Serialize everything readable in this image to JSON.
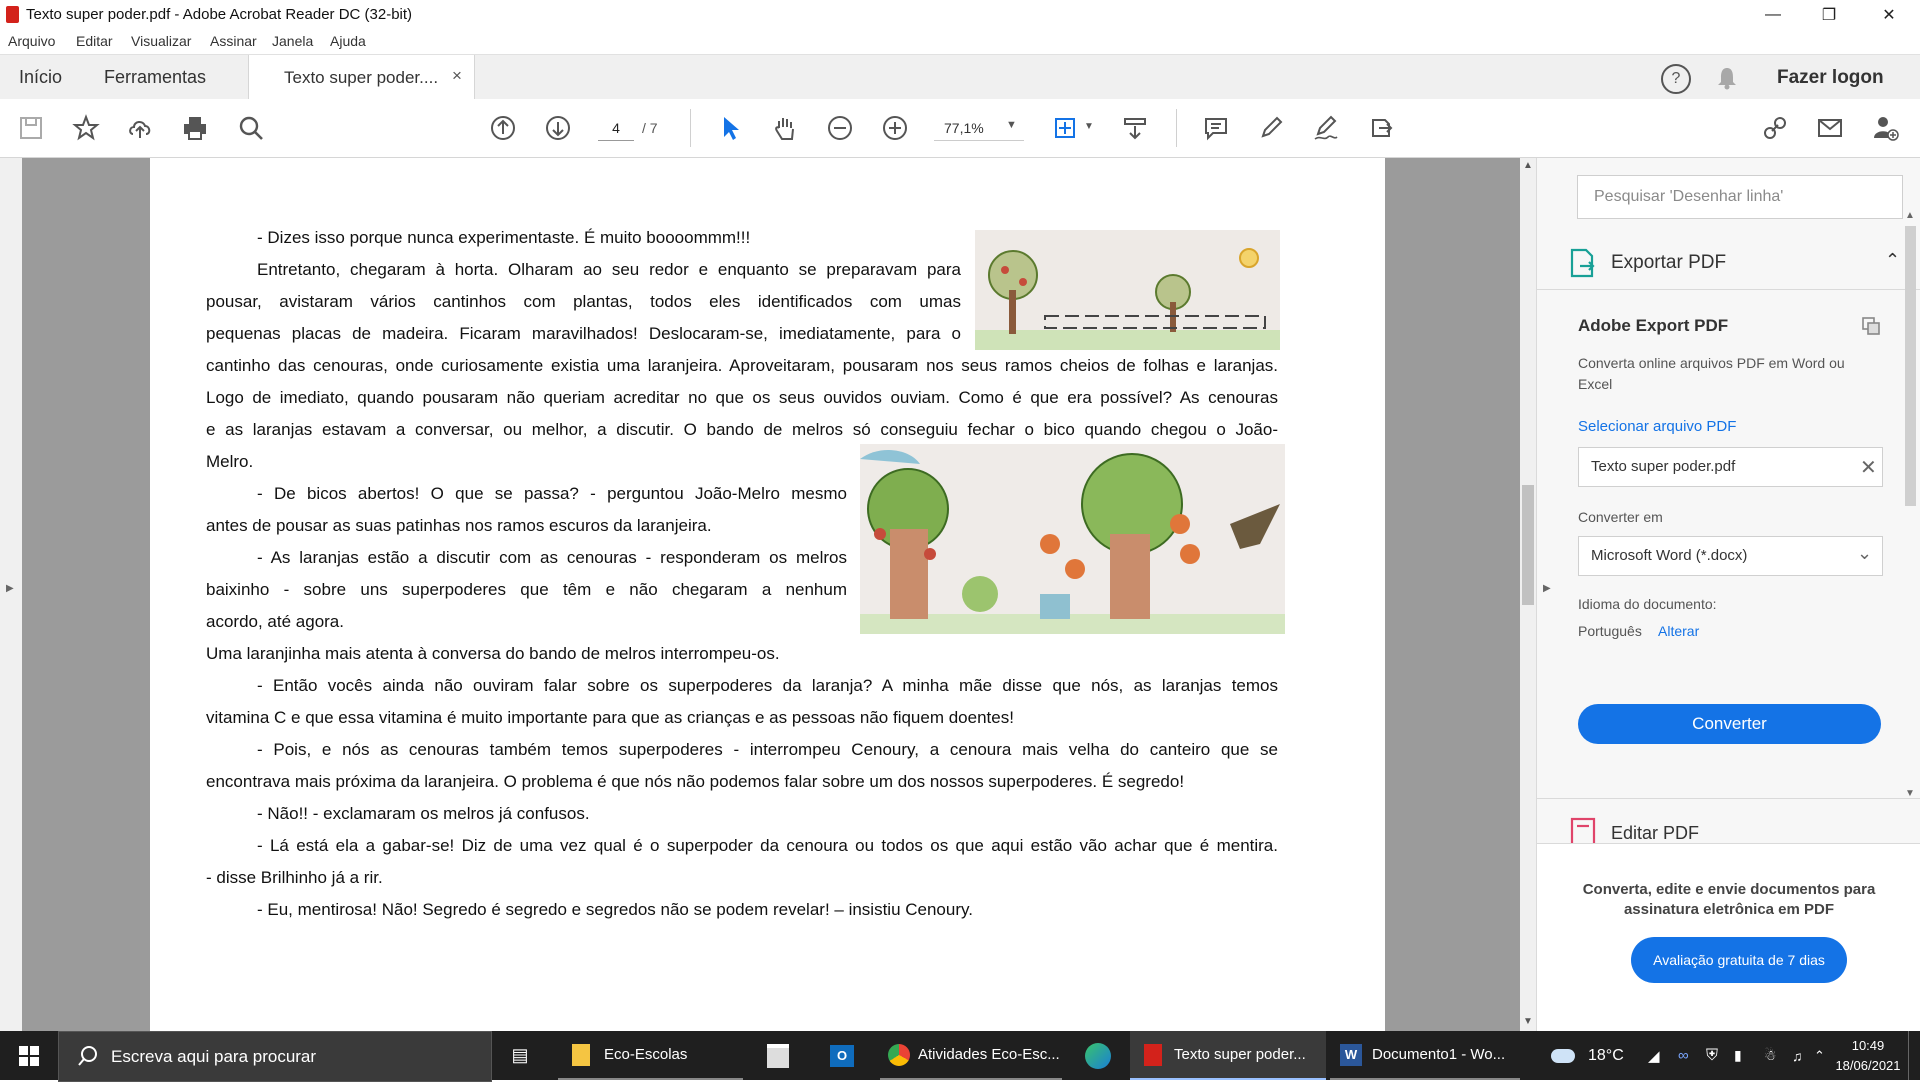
{
  "window": {
    "title": "Texto super poder.pdf - Adobe Acrobat Reader DC (32-bit)"
  },
  "menu": [
    "Arquivo",
    "Editar",
    "Visualizar",
    "Assinar",
    "Janela",
    "Ajuda"
  ],
  "tabs": {
    "home": "Início",
    "tools": "Ferramentas",
    "document": "Texto super poder....",
    "login": "Fazer logon"
  },
  "toolbar": {
    "page_current": "4",
    "page_total": "/ 7",
    "zoom": "77,1%"
  },
  "document": {
    "paragraphs": [
      "- Dizes isso porque nunca experimentaste. É muito boooommm!!!",
      "Entretanto, chegaram à horta. Olharam ao seu redor e enquanto se preparavam para",
      "pousar, avistaram vários cantinhos com plantas, todos eles identificados com umas",
      "pequenas placas de madeira. Ficaram maravilhados! Deslocaram-se, imediatamente, para o",
      "cantinho das cenouras, onde curiosamente existia uma laranjeira. Aproveitaram, pousaram nos seus ramos cheios de folhas e laranjas.",
      "Logo de imediato, quando pousaram não queriam acreditar no que os seus ouvidos ouviam. Como é que era possível? As cenouras",
      "e as laranjas estavam a conversar, ou melhor, a discutir. O bando de melros só conseguiu fechar o bico quando chegou o João-",
      "Melro.",
      "- De bicos abertos! O que se passa? - perguntou João-Melro mesmo",
      "antes de pousar as suas patinhas nos ramos escuros da laranjeira.",
      "- As laranjas estão a discutir com as cenouras - responderam os melros",
      "baixinho - sobre uns superpoderes que têm e não chegaram a nenhum",
      "acordo, até agora.",
      "Uma laranjinha mais atenta à conversa do bando de melros interrompeu-os.",
      "- Então vocês ainda não ouviram falar sobre os superpoderes da laranja? A minha mãe disse que nós, as laranjas temos",
      "vitamina C e que essa vitamina é muito importante para que as crianças e as pessoas não fiquem doentes!",
      "- Pois, e nós as cenouras também temos superpoderes - interrompeu Cenoury, a cenoura mais velha do canteiro que se",
      "encontrava mais próxima da laranjeira. O problema é que nós não podemos falar sobre um dos nossos superpoderes. É segredo!",
      "- Não!! - exclamaram os melros já confusos.",
      "- Lá está ela a gabar-se! Diz de uma vez qual é o superpoder da cenoura ou todos os que aqui estão vão achar que é mentira.",
      "- disse Brilhinho já a rir.",
      "- Eu, mentirosa! Não! Segredo é segredo e segredos não se podem revelar! – insistiu Cenoury."
    ]
  },
  "panel": {
    "search_placeholder": "Pesquisar 'Desenhar linha'",
    "export_title": "Exportar PDF",
    "adobe_export": "Adobe Export PDF",
    "convert_desc": "Converta online arquivos PDF em Word ou Excel",
    "select_file": "Selecionar arquivo PDF",
    "file_name": "Texto super poder.pdf",
    "convert_to_label": "Converter em",
    "convert_to_value": "Microsoft Word (*.docx)",
    "doc_lang_label": "Idioma do documento:",
    "doc_lang_value": "Português",
    "change": "Alterar",
    "convert_button": "Converter",
    "edit_pdf": "Editar PDF",
    "promo": "Converta, edite e envie documentos para assinatura eletrônica em PDF",
    "trial_button": "Avaliação gratuita de 7 dias"
  },
  "taskbar": {
    "search": "Escreva aqui para procurar",
    "apps": [
      "Eco-Escolas",
      "Atividades Eco-Esc...",
      "Texto super poder...",
      "Documento1 - Wo..."
    ],
    "temp": "18°C",
    "time": "10:49",
    "date": "18/06/2021"
  },
  "colors": {
    "accent": "#1473e6",
    "link": "#1473e6",
    "taskbar": "#1f1f1f"
  }
}
